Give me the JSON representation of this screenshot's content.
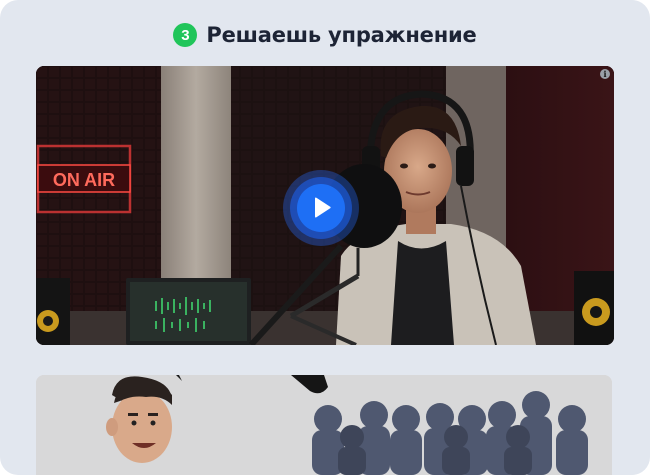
{
  "step": {
    "number": "3",
    "title": "Решаешь упражнение",
    "badge_color": "#20c55a"
  },
  "video": {
    "sign_text": "ON AIR",
    "info_icon": "info-icon",
    "play_icon": "play-icon",
    "accent_color": "#1e6ff5"
  },
  "illustration": {
    "subject": "cartoon-man-and-audience"
  }
}
